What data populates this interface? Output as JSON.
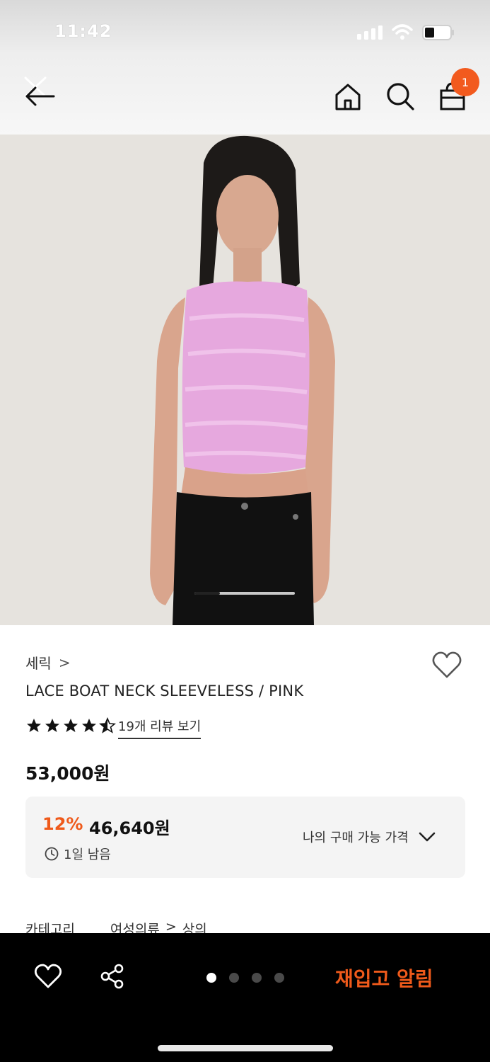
{
  "status_bar": {
    "time": "11:42"
  },
  "header": {
    "icons": [
      "back-arrow-icon",
      "home-icon",
      "search-icon",
      "shopping-bag-icon"
    ],
    "cart_count": "1",
    "accent_color": "#f25a1e"
  },
  "product": {
    "brand": "세릭",
    "brand_chevron": ">",
    "name": "LACE BOAT NECK SLEEVELESS / PINK",
    "rating": 4.5,
    "review_link": "19개 리뷰 보기",
    "price": "53,000원",
    "discount": {
      "percent": "12%",
      "price": "46,640원",
      "remaining": "1일 남음",
      "my_price_label": "나의 구매 가능 가격"
    },
    "category": {
      "label": "카테고리",
      "path": [
        "여성의류",
        ">",
        "상의"
      ]
    },
    "image_carousel": {
      "position": 1,
      "total": 4
    }
  },
  "bottom_bar": {
    "page_dots": 4,
    "active_dot": 0,
    "restock_label": "재입고 알림",
    "restock_color": "#ef5a1b"
  }
}
